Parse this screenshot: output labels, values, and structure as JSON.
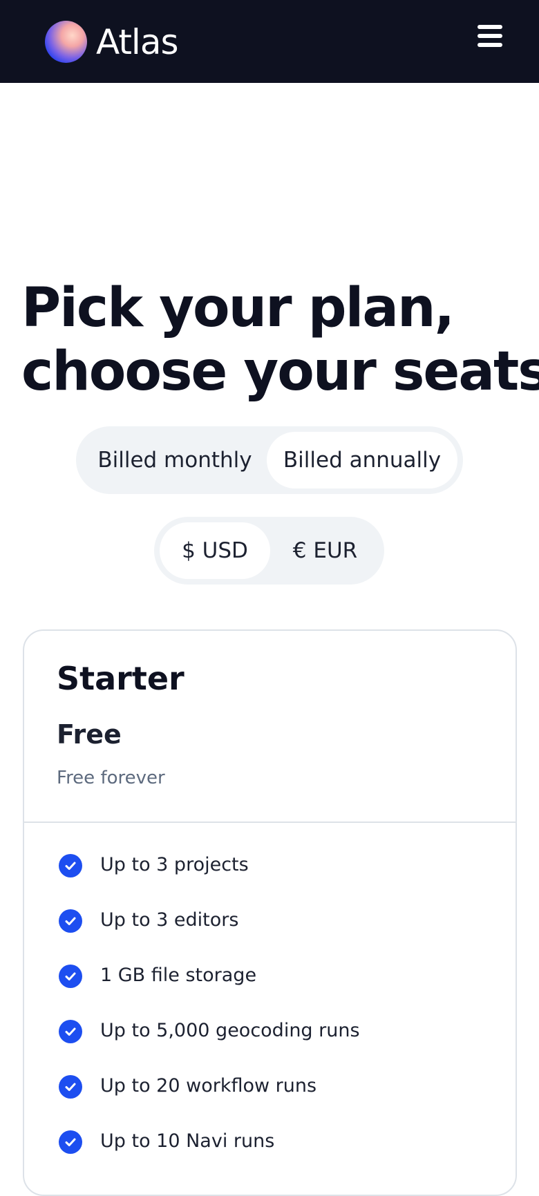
{
  "header": {
    "brand": "Atlas",
    "logo_icon": "atlas-orb-logo",
    "menu_icon": "hamburger-menu-icon",
    "background": "#0e1120"
  },
  "hero": {
    "title_line1": "Pick your plan,",
    "title_line2": "choose your seats"
  },
  "billing_toggle": {
    "options": [
      "Billed monthly",
      "Billed annually"
    ],
    "selected": "Billed annually"
  },
  "currency_toggle": {
    "options": [
      "$ USD",
      "€ EUR"
    ],
    "selected": "$ USD"
  },
  "plan": {
    "name": "Starter",
    "price": "Free",
    "subtitle": "Free forever",
    "features": [
      "Up to 3 projects",
      "Up to 3 editors",
      "1 GB file storage",
      "Up to 5,000 geocoding runs",
      "Up to 20 workflow runs",
      "Up to 10 Navi runs"
    ],
    "feature_icon": "check-circle-icon"
  },
  "colors": {
    "accent": "#1d4ef0",
    "text_dark": "#0e1120",
    "muted": "#5d6a7e",
    "toggle_bg": "#f0f3f6"
  }
}
